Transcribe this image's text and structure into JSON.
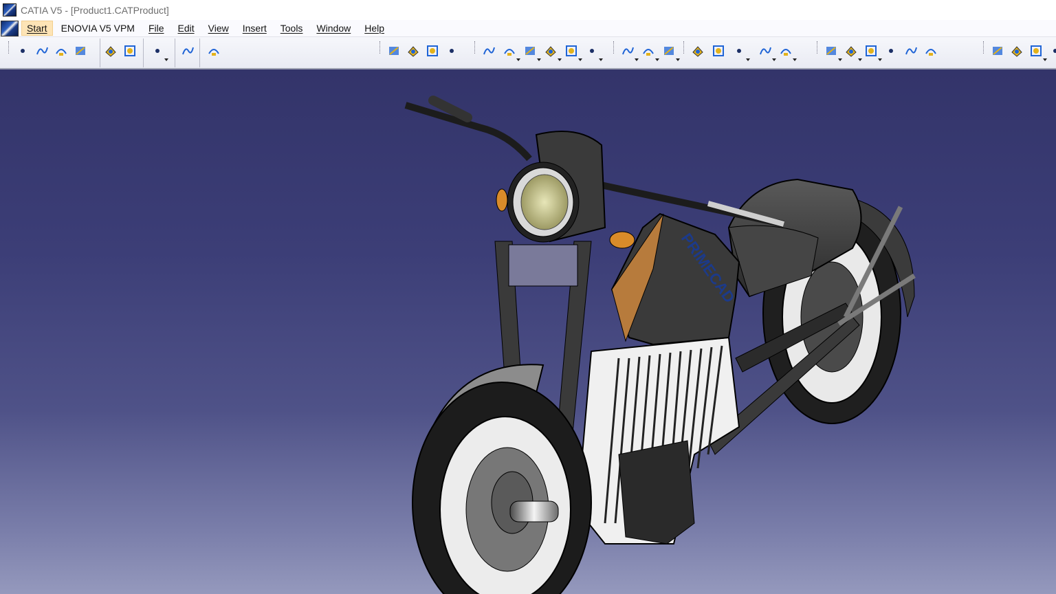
{
  "window": {
    "title": "CATIA V5 - [Product1.CATProduct]"
  },
  "menubar": {
    "items": [
      {
        "label": "Start",
        "active": true
      },
      {
        "label": "ENOVIA V5 VPM",
        "active": false
      },
      {
        "label": "File",
        "active": false
      },
      {
        "label": "Edit",
        "active": false
      },
      {
        "label": "View",
        "active": false
      },
      {
        "label": "Insert",
        "active": false
      },
      {
        "label": "Tools",
        "active": false
      },
      {
        "label": "Window",
        "active": false
      },
      {
        "label": "Help",
        "active": false
      }
    ]
  },
  "toolbar": {
    "icons": [
      "point-icon",
      "spline-icon",
      "arc-icon",
      "sketch-tool-icon",
      "part-body-icon",
      "part-body-copy-icon",
      "assembly-icon",
      "constraint-icon",
      "sketcher-icon",
      "extrude-surface-icon",
      "sweep-surface-icon",
      "fill-surface-icon",
      "blend-surface-icon",
      "pattern-icon",
      "axis-system-icon",
      "circle-surface-icon",
      "helix-icon",
      "split-icon",
      "transform-icon",
      "point-create-icon",
      "curve-create-icon",
      "plane-create-icon",
      "offset-surface-icon",
      "join-icon",
      "heal-icon",
      "sphere-icon",
      "cylinder-icon",
      "measure-icon",
      "analysis-icon",
      "draft-analysis-icon",
      "curvature-icon",
      "mapping-icon",
      "lighting-icon",
      "render-icon",
      "shading-icon",
      "snapshot-icon",
      "more-icon"
    ],
    "accent": "#1f64d6",
    "secondary": "#e3b21a"
  },
  "viewport": {
    "background_top": "#33346a",
    "background_bottom": "#9599bd",
    "model_label": "PRIMECAD"
  }
}
